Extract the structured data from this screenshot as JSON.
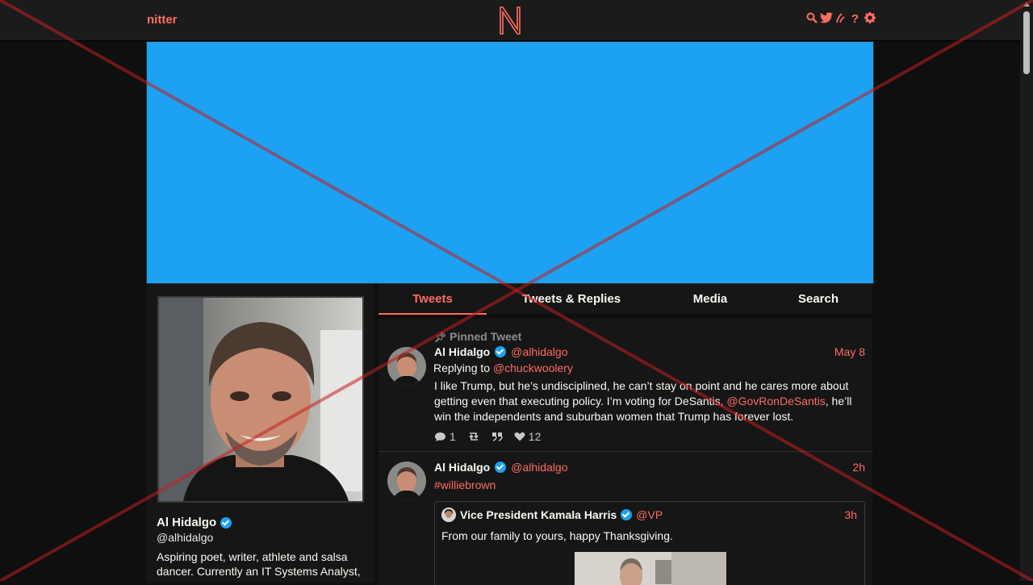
{
  "navbar": {
    "logo_text": "nitter",
    "icons": [
      "search-icon",
      "twitter-bird-icon",
      "rss-icon",
      "help-icon",
      "gear-icon"
    ]
  },
  "colors": {
    "accent": "#ff6c60",
    "banner": "#1da1f2",
    "background": "#0f0f0f",
    "panel": "#161616",
    "verified": "#1da1f2"
  },
  "profile": {
    "fullname": "Al Hidalgo",
    "handle": "@alhidalgo",
    "bio": "Aspiring poet, writer, athlete and salsa dancer. Currently an IT Systems Analyst,"
  },
  "tabs": [
    {
      "label": "Tweets",
      "active": true
    },
    {
      "label": "Tweets & Replies",
      "active": false
    },
    {
      "label": "Media",
      "active": false
    },
    {
      "label": "Search",
      "active": false
    }
  ],
  "tweets": [
    {
      "pinned_label": "Pinned Tweet",
      "fullname": "Al Hidalgo",
      "handle": "@alhidalgo",
      "date": "May 8",
      "replying_prefix": "Replying to",
      "replying_to": "@chuckwoolery",
      "body_before": "I like Trump, but he’s undisciplined, he can’t stay on point and he cares more about getting even that executing policy. I’m voting for DeSantis, ",
      "body_mention": "@GovRonDeSantis",
      "body_after": ", he’ll win the independents and suburban women that Trump has forever lost.",
      "stats": {
        "replies": "1",
        "retweets": "",
        "quotes": "",
        "likes": "12"
      }
    },
    {
      "fullname": "Al Hidalgo",
      "handle": "@alhidalgo",
      "date": "2h",
      "hashtag": "#williebrown",
      "quote": {
        "fullname": "Vice President Kamala Harris",
        "handle": "@VP",
        "date": "3h",
        "body": "From our family to yours, happy Thanksgiving."
      }
    }
  ]
}
